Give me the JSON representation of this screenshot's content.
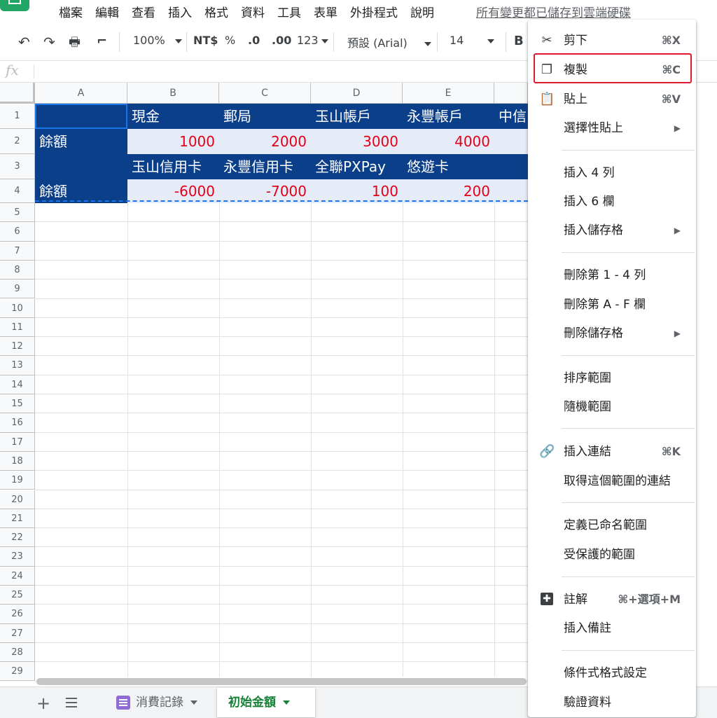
{
  "menubar": {
    "items": [
      "檔案",
      "編輯",
      "查看",
      "插入",
      "格式",
      "資料",
      "工具",
      "表單",
      "外掛程式",
      "說明"
    ],
    "save_status": "所有變更都已儲存到雲端硬碟"
  },
  "toolbar": {
    "zoom": "100%",
    "currency": "NT$",
    "percent": "%",
    "dec_decrease": ".0",
    "dec_increase": ".00",
    "number_format": "123",
    "font": "預設 (Arial)",
    "font_size": "14",
    "bold": "B"
  },
  "formula_bar": {
    "fx": "fx",
    "value": ""
  },
  "columns": [
    "A",
    "B",
    "C",
    "D",
    "E"
  ],
  "rows": [
    "1",
    "2",
    "3",
    "4",
    "5",
    "6",
    "7",
    "8",
    "9",
    "10",
    "11",
    "12",
    "13",
    "14",
    "15",
    "16",
    "17",
    "18",
    "19",
    "20",
    "21",
    "22",
    "23",
    "24",
    "25",
    "26",
    "27",
    "28",
    "29"
  ],
  "cells": {
    "r1": [
      "",
      "現金",
      "郵局",
      "玉山帳戶",
      "永豐帳戶",
      "中信"
    ],
    "r2": [
      "餘額",
      "1000",
      "2000",
      "3000",
      "4000",
      ""
    ],
    "r3": [
      "",
      "玉山信用卡",
      "永豐信用卡",
      "全聯PXPay",
      "悠遊卡",
      ""
    ],
    "r4": [
      "餘額",
      "-6000",
      "-7000",
      "100",
      "200",
      ""
    ]
  },
  "sheet_tabs": {
    "add": "+",
    "tabs": [
      {
        "label": "消費記錄",
        "active": false
      },
      {
        "label": "初始金額",
        "active": true
      }
    ]
  },
  "context_menu": {
    "items": [
      {
        "label": "剪下",
        "shortcut": "⌘X",
        "icon": "scissors-icon"
      },
      {
        "label": "複製",
        "shortcut": "⌘C",
        "icon": "copy-icon",
        "highlighted": true
      },
      {
        "label": "貼上",
        "shortcut": "⌘V",
        "icon": "clipboard-icon"
      },
      {
        "label": "選擇性貼上",
        "submenu": true
      },
      {
        "label": "插入 4 列"
      },
      {
        "label": "插入 6 欄"
      },
      {
        "label": "插入儲存格",
        "submenu": true
      },
      {
        "label": "刪除第 1 - 4 列"
      },
      {
        "label": "刪除第 A - F 欄"
      },
      {
        "label": "刪除儲存格",
        "submenu": true
      },
      {
        "label": "排序範圍"
      },
      {
        "label": "隨機範圍"
      },
      {
        "label": "插入連結",
        "shortcut": "⌘K",
        "icon": "link-icon"
      },
      {
        "label": "取得這個範圍的連結"
      },
      {
        "label": "定義已命名範圍"
      },
      {
        "label": "受保護的範圍"
      },
      {
        "label": "註解",
        "shortcut": "⌘+選項+M",
        "icon": "add-comment-icon"
      },
      {
        "label": "插入備註"
      },
      {
        "label": "條件式格式設定"
      },
      {
        "label": "驗證資料"
      }
    ],
    "submenu_arrow": "▶"
  },
  "colors": {
    "header_fill": "#0b3f8a",
    "value_fill": "#e6ecf7",
    "value_text": "#e2001a",
    "active_tab": "#188038",
    "highlight": "#e0192c"
  }
}
